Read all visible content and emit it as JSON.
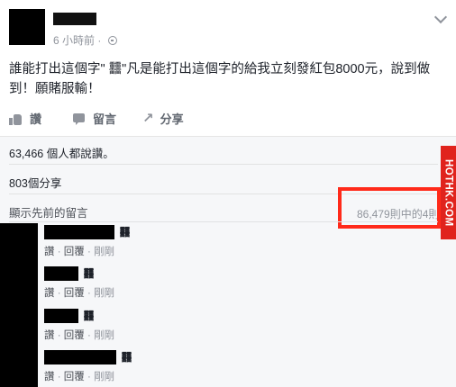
{
  "post": {
    "time": "6 小時前",
    "dot": "·",
    "text": "誰能打出這個字\" 䨻\"凡是能打出這個字的給我立刻發紅包8000元，說到做到！願賭服輸！"
  },
  "actions": {
    "like_label": "讚",
    "comment_label": "留言",
    "share_label": "分享",
    "share_icon": "↗"
  },
  "ufi": {
    "likes_summary": "63,466 個人都說讚。",
    "shares_summary": "803個分享",
    "view_previous": "顯示先前的留言",
    "comment_count": "86,479則中的4則"
  },
  "watermark": "HOTHK.COM",
  "comments": [
    {
      "glyph": "䨻",
      "like": "讚",
      "reply": "回覆",
      "time": "剛剛",
      "sep": "·"
    },
    {
      "glyph": "䨻",
      "like": "讚",
      "reply": "回覆",
      "time": "剛剛",
      "sep": "·"
    },
    {
      "glyph": "䨻",
      "like": "讚",
      "reply": "回覆",
      "time": "剛剛",
      "sep": "·"
    },
    {
      "glyph": "䨻",
      "like": "讚",
      "reply": "回覆",
      "time": "剛剛",
      "sep": "·"
    }
  ],
  "icons": {
    "globe": "globe-icon",
    "chevron": "chevron-down-icon",
    "like": "thumbs-up-icon",
    "comment": "comment-bubble-icon",
    "share": "share-arrow-icon"
  },
  "colors": {
    "highlight": "#ff2a1a",
    "watermark_bg": "#e0231d",
    "ufi_bg": "#f6f7f9"
  }
}
